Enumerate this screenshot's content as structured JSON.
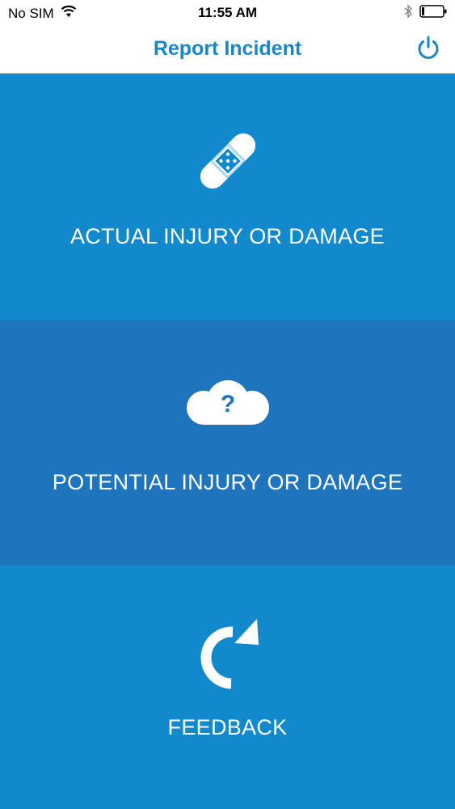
{
  "status_bar": {
    "carrier": "No SIM",
    "time": "11:55 AM",
    "icons": [
      "wifi-icon",
      "bluetooth-icon",
      "battery-icon"
    ]
  },
  "nav": {
    "title": "Report Incident",
    "power_icon": "power-icon"
  },
  "tiles": [
    {
      "label": "ACTUAL INJURY OR DAMAGE",
      "icon": "bandage-icon"
    },
    {
      "label": "POTENTIAL INJURY OR DAMAGE",
      "icon": "question-cloud-icon"
    },
    {
      "label": "FEEDBACK",
      "icon": "refresh-arrow-icon"
    }
  ],
  "colors": {
    "accent": "#1a86c8",
    "tile_primary": "#1189cc",
    "tile_secondary": "#1f75bd",
    "text_on_tile": "#ffffff"
  }
}
